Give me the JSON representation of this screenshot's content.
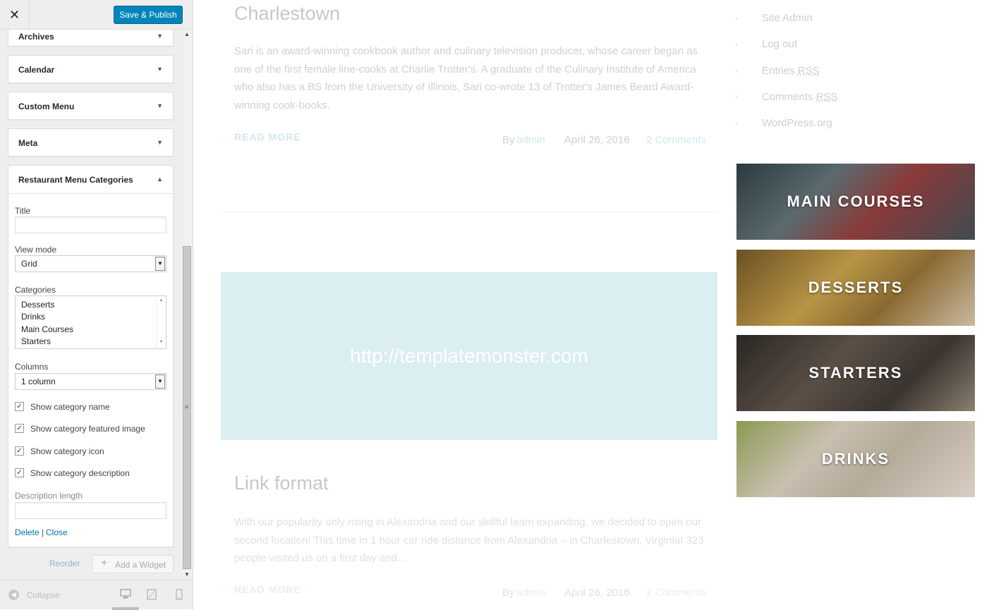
{
  "topbar": {
    "close_glyph": "✕",
    "publish_label": "Save & Publish"
  },
  "widgets": [
    {
      "title": "Archives",
      "arrow": "▼"
    },
    {
      "title": "Calendar",
      "arrow": "▼"
    },
    {
      "title": "Custom Menu",
      "arrow": "▼"
    },
    {
      "title": "Meta",
      "arrow": "▼"
    }
  ],
  "rmc": {
    "title": "Restaurant Menu Categories",
    "arrow": "▲",
    "title_label": "Title",
    "title_value": "",
    "view_mode_label": "View mode",
    "view_mode_value": "Grid",
    "categories_label": "Categories",
    "categories": [
      "Desserts",
      "Drinks",
      "Main Courses",
      "Starters"
    ],
    "columns_label": "Columns",
    "columns_value": "1 column",
    "checkboxes": [
      {
        "label": "Show category name",
        "checked": true
      },
      {
        "label": "Show category featured image",
        "checked": true
      },
      {
        "label": "Show category icon",
        "checked": true
      },
      {
        "label": "Show category description",
        "checked": true
      }
    ],
    "desc_length_label": "Description length",
    "desc_length_value": "",
    "delete_label": "Delete",
    "separator": "|",
    "close_label": "Close"
  },
  "footer_actions": {
    "reorder_label": "Reorder",
    "add_widget_label": "Add a Widget"
  },
  "footer": {
    "collapse_label": "Collapse"
  },
  "posts": [
    {
      "title": "Charlestown",
      "excerpt": "Sari is an award-winning cookbook author and culinary television producer, whose career began as one of the first female line-cooks at Charlie Trotter's. A graduate of the Culinary Institute of America who also has a BS from the University of Illinois, Sari co-wrote 13 of Trotter's James Beard Award-winning cook-books.",
      "read_more": "READ MORE",
      "by": "By",
      "author": "admin",
      "date": "April 26, 2016",
      "comments": "2 Comments"
    },
    {
      "title": "Link format",
      "excerpt": "With our popularity only rising in Alexandria and our skillful team expanding, we decided to open our second location! This time in 1 hour car ride distance from Alexandria – in Charlestown, Virginia! 323 people visited us on a first day and...",
      "read_more": "READ MORE",
      "by": "By",
      "author": "admin",
      "date": "April 26, 2016",
      "comments": "2 Comments"
    }
  ],
  "link_post": {
    "url": "http://templatemonster.com"
  },
  "meta_links": [
    {
      "text": "Site Admin",
      "abbr": ""
    },
    {
      "text": "Log out",
      "abbr": ""
    },
    {
      "text": "Entries ",
      "abbr": "RSS"
    },
    {
      "text": "Comments ",
      "abbr": "RSS"
    },
    {
      "text": "WordPress.org",
      "abbr": ""
    }
  ],
  "menu_categories": [
    {
      "name": "MAIN COURSES",
      "image": "fish-on-ice",
      "color": "#3b4a50"
    },
    {
      "name": "DESSERTS",
      "image": "pastry-slices",
      "color": "#8a6a32"
    },
    {
      "name": "STARTERS",
      "image": "olives-and-cheese",
      "color": "#403a34"
    },
    {
      "name": "DRINKS",
      "image": "tea-cup-and-fruit",
      "color": "#b4aa9a"
    }
  ],
  "colors": {
    "publish": "#0085ba",
    "link": "#0073aa",
    "link_post_bg": "#dbeef2"
  }
}
